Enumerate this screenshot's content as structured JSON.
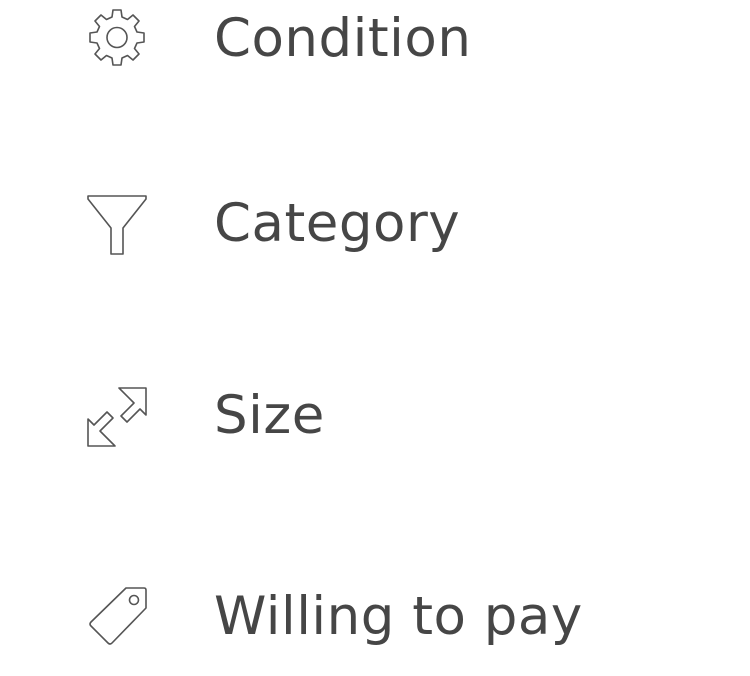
{
  "filters": {
    "items": [
      {
        "label": "Condition",
        "icon": "gear-icon"
      },
      {
        "label": "Category",
        "icon": "funnel-icon"
      },
      {
        "label": "Size",
        "icon": "expand-arrows-icon"
      },
      {
        "label": "Willing to pay",
        "icon": "price-tag-icon"
      }
    ]
  },
  "colors": {
    "text": "#464646",
    "icon_stroke": "#555555",
    "background": "#ffffff"
  }
}
